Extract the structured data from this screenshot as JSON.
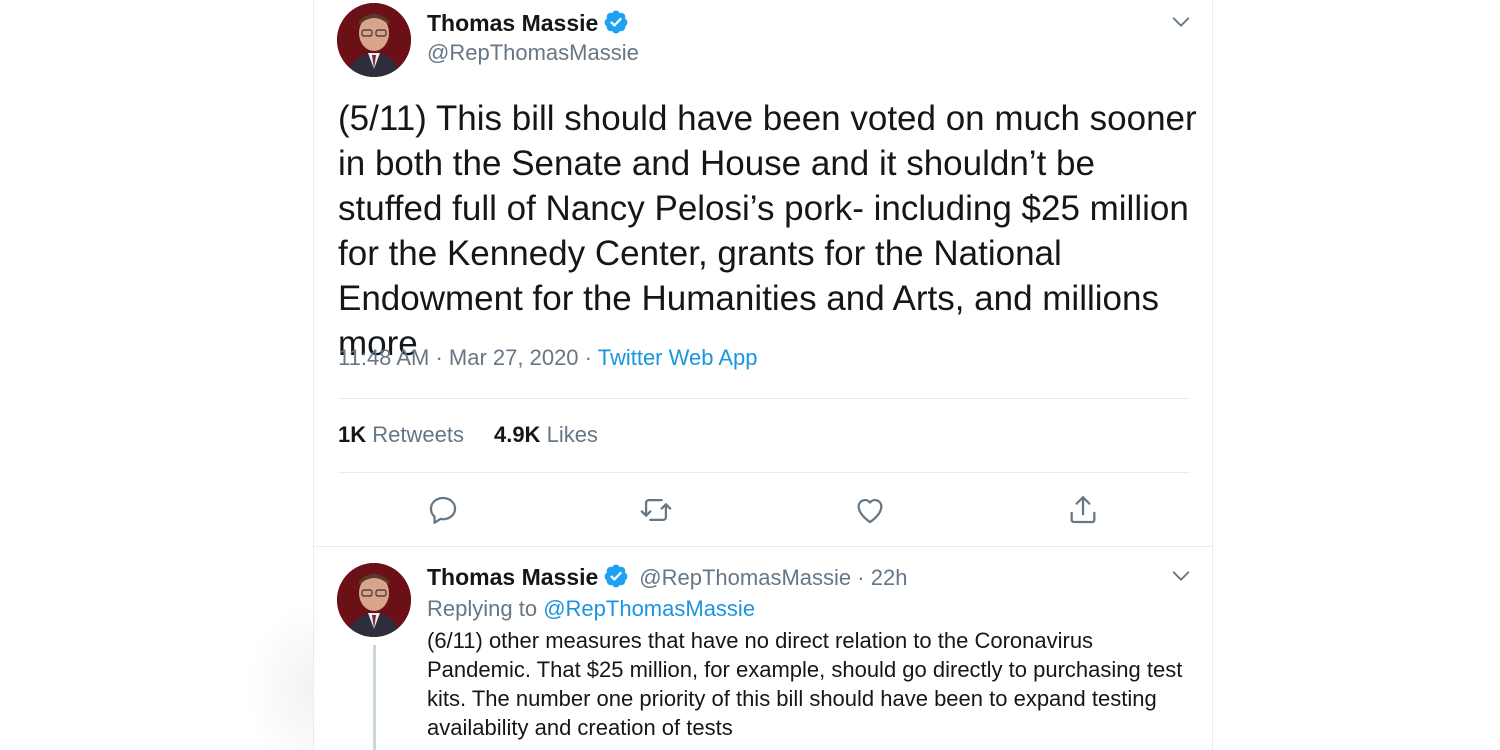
{
  "tweet": {
    "author_name": "Thomas Massie",
    "author_handle": "@RepThomasMassie",
    "text": "(5/11) This bill should have been voted on much sooner in both the Senate and House and it shouldn’t be stuffed full of Nancy Pelosi’s pork- including $25 million for the Kennedy Center, grants for the National Endowment for the Humanities and Arts, and millions more",
    "time": "11:48 AM",
    "date": "Mar 27, 2020",
    "separator": "·",
    "source": "Twitter Web App",
    "retweets_count": "1K",
    "retweets_label": "Retweets",
    "likes_count": "4.9K",
    "likes_label": "Likes",
    "actions": [
      "reply-icon",
      "retweet-icon",
      "like-icon",
      "share-icon"
    ]
  },
  "reply": {
    "author_name": "Thomas Massie",
    "author_handle": "@RepThomasMassie",
    "time_ago": "22h",
    "separator": "·",
    "replying_to_label": "Replying to",
    "replying_to_handle": "@RepThomasMassie",
    "text": "(6/11) other measures that have no direct relation to the Coronavirus Pandemic. That $25 million, for example, should go directly to purchasing test kits. The number one priority of this bill should have been to expand testing availability and creation of tests"
  },
  "colors": {
    "link": "#1b95e0",
    "muted": "#657786",
    "text": "#14171a",
    "verified": "#1da1f2",
    "divider": "#e6ecf0"
  }
}
